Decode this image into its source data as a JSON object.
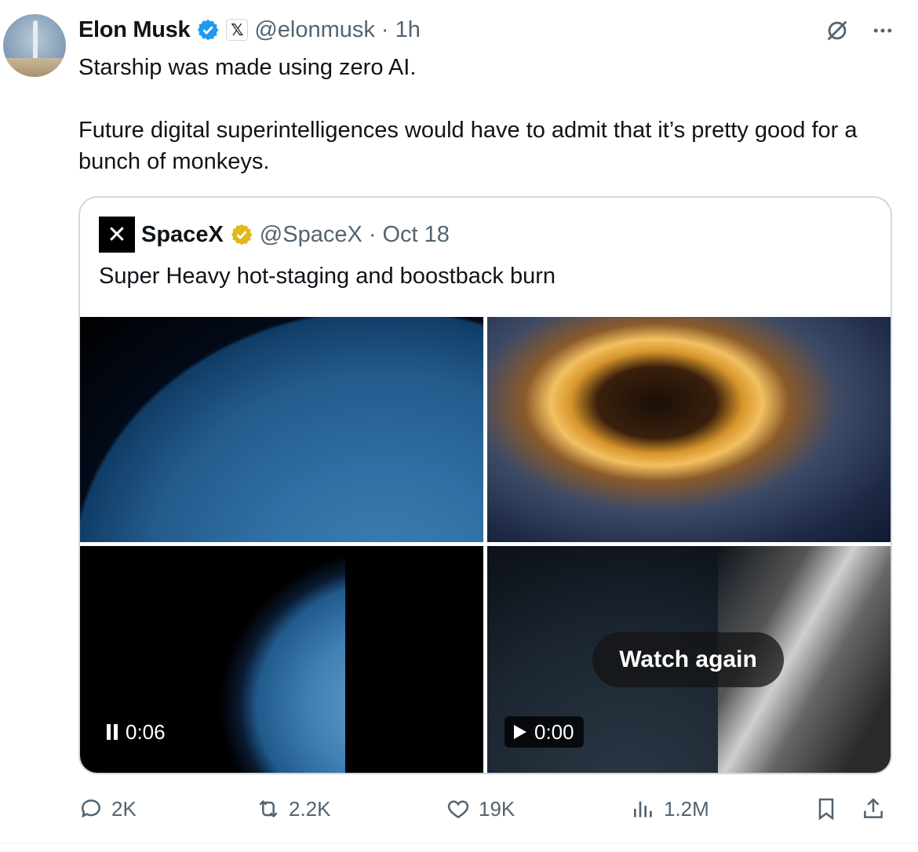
{
  "tweet": {
    "author_name": "Elon Musk",
    "author_handle": "@elonmusk",
    "separator": "·",
    "time": "1h",
    "affiliation_badge": "𝕏",
    "text_line1": "Starship was made using zero AI.",
    "text_line2": "Future digital superintelligences would have to admit that it’s pretty good for a bunch of monkeys."
  },
  "quoted": {
    "author_name": "SpaceX",
    "author_handle": "@SpaceX",
    "separator": "·",
    "date": "Oct 18",
    "logo_text": "✕",
    "text": "Super Heavy hot-staging and boostback burn",
    "media": {
      "watch_again": "Watch again",
      "video1_time": "0:06",
      "video2_time": "0:00"
    }
  },
  "actions": {
    "replies": "2K",
    "reposts": "2.2K",
    "likes": "19K",
    "views": "1.2M"
  },
  "icons": {
    "verified": "verified-blue-check-icon",
    "verified_gold": "verified-gold-check-icon",
    "grok": "grok-slash-icon",
    "more": "more-dots-icon",
    "reply": "reply-bubble-icon",
    "repost": "repost-icon",
    "like": "heart-icon",
    "views": "bar-chart-icon",
    "bookmark": "bookmark-icon",
    "share": "share-icon"
  },
  "colors": {
    "verified_blue": "#1d9bf0",
    "verified_gold": "#e2b719",
    "secondary_text": "#536471"
  }
}
